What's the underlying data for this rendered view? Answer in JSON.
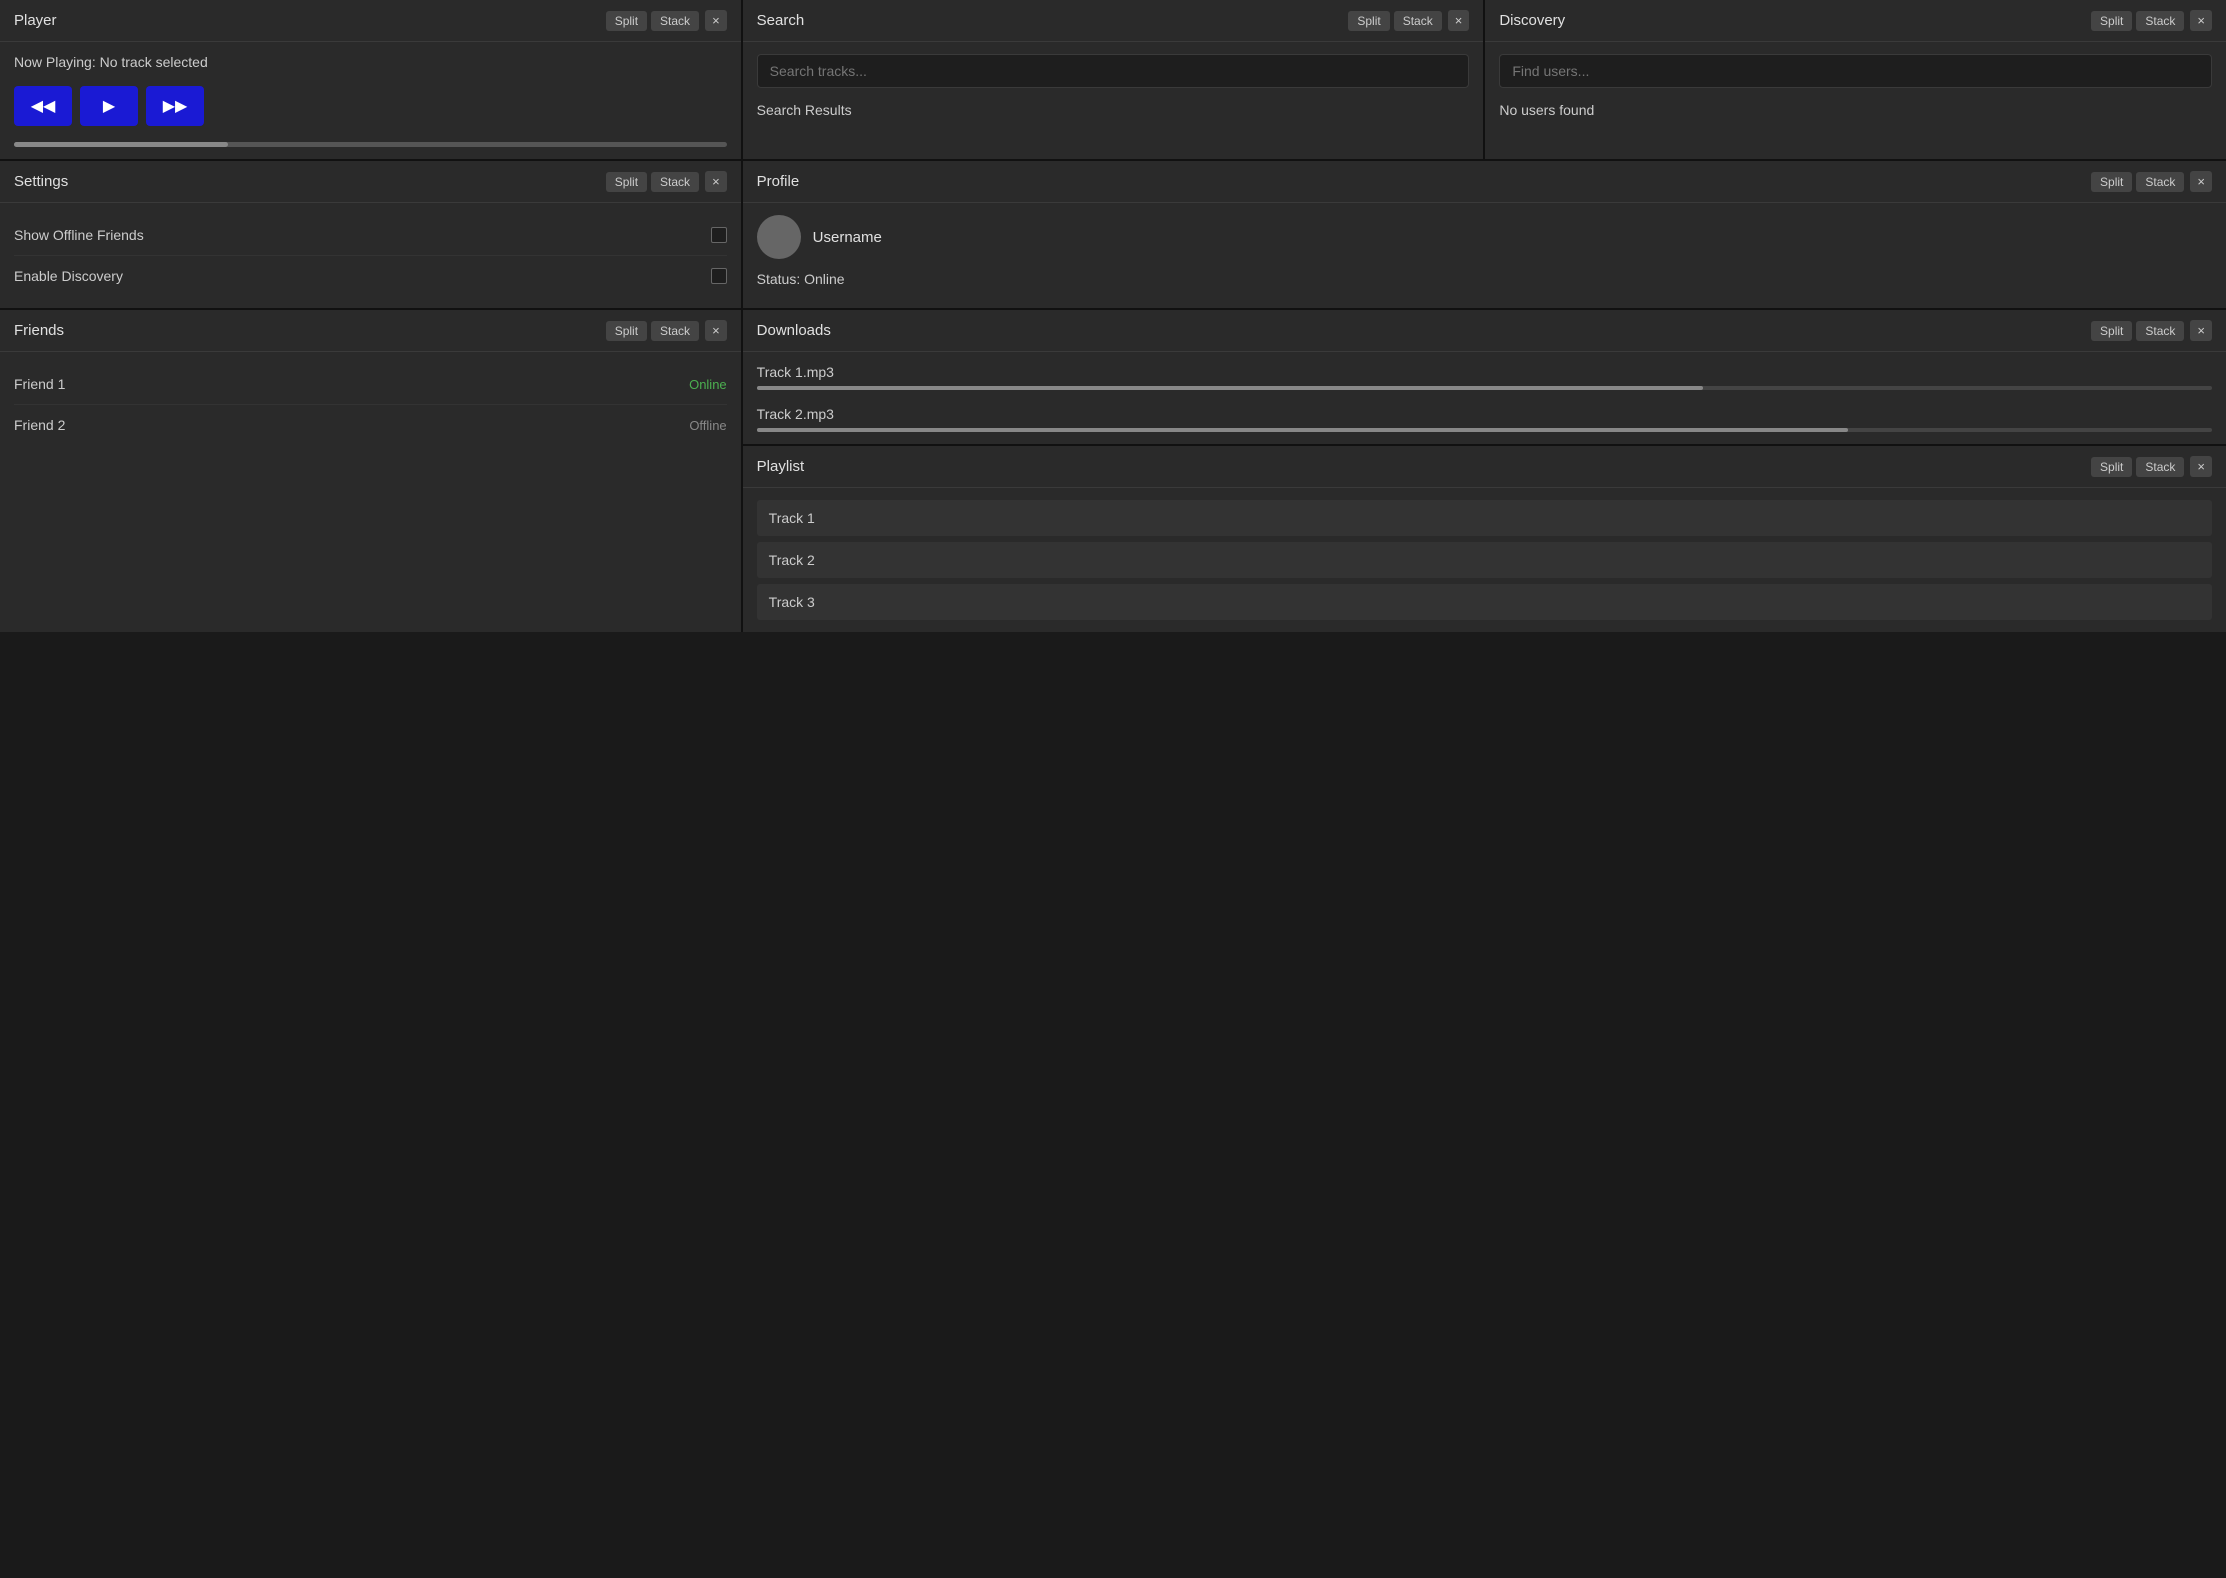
{
  "player": {
    "title": "Player",
    "now_playing": "Now Playing: No track selected",
    "btn_split": "Split",
    "btn_stack": "Stack",
    "btn_close": "×",
    "btn_rewind": "◀◀",
    "btn_play": "▶",
    "btn_forward": "▶▶",
    "progress": 30
  },
  "search": {
    "title": "Search",
    "placeholder": "Search tracks...",
    "results_label": "Search Results",
    "btn_split": "Split",
    "btn_stack": "Stack",
    "btn_close": "×"
  },
  "discovery": {
    "title": "Discovery",
    "placeholder": "Find users...",
    "no_users_label": "No users found",
    "btn_split": "Split",
    "btn_stack": "Stack",
    "btn_close": "×"
  },
  "settings": {
    "title": "Settings",
    "btn_split": "Split",
    "btn_stack": "Stack",
    "btn_close": "×",
    "rows": [
      {
        "label": "Show Offline Friends"
      },
      {
        "label": "Enable Discovery"
      }
    ]
  },
  "profile": {
    "title": "Profile",
    "username": "Username",
    "status": "Status: Online",
    "btn_split": "Split",
    "btn_stack": "Stack",
    "btn_close": "×"
  },
  "friends": {
    "title": "Friends",
    "btn_split": "Split",
    "btn_stack": "Stack",
    "btn_close": "×",
    "items": [
      {
        "name": "Friend 1",
        "status": "Online",
        "online": true
      },
      {
        "name": "Friend 2",
        "status": "Offline",
        "online": false
      }
    ]
  },
  "downloads": {
    "title": "Downloads",
    "btn_split": "Split",
    "btn_stack": "Stack",
    "btn_close": "×",
    "items": [
      {
        "name": "Track 1.mp3",
        "progress": 65
      },
      {
        "name": "Track 2.mp3",
        "progress": 75
      }
    ]
  },
  "playlist": {
    "title": "Playlist",
    "btn_split": "Split",
    "btn_stack": "Stack",
    "btn_close": "×",
    "items": [
      {
        "name": "Track 1"
      },
      {
        "name": "Track 2"
      },
      {
        "name": "Track 3"
      }
    ]
  }
}
